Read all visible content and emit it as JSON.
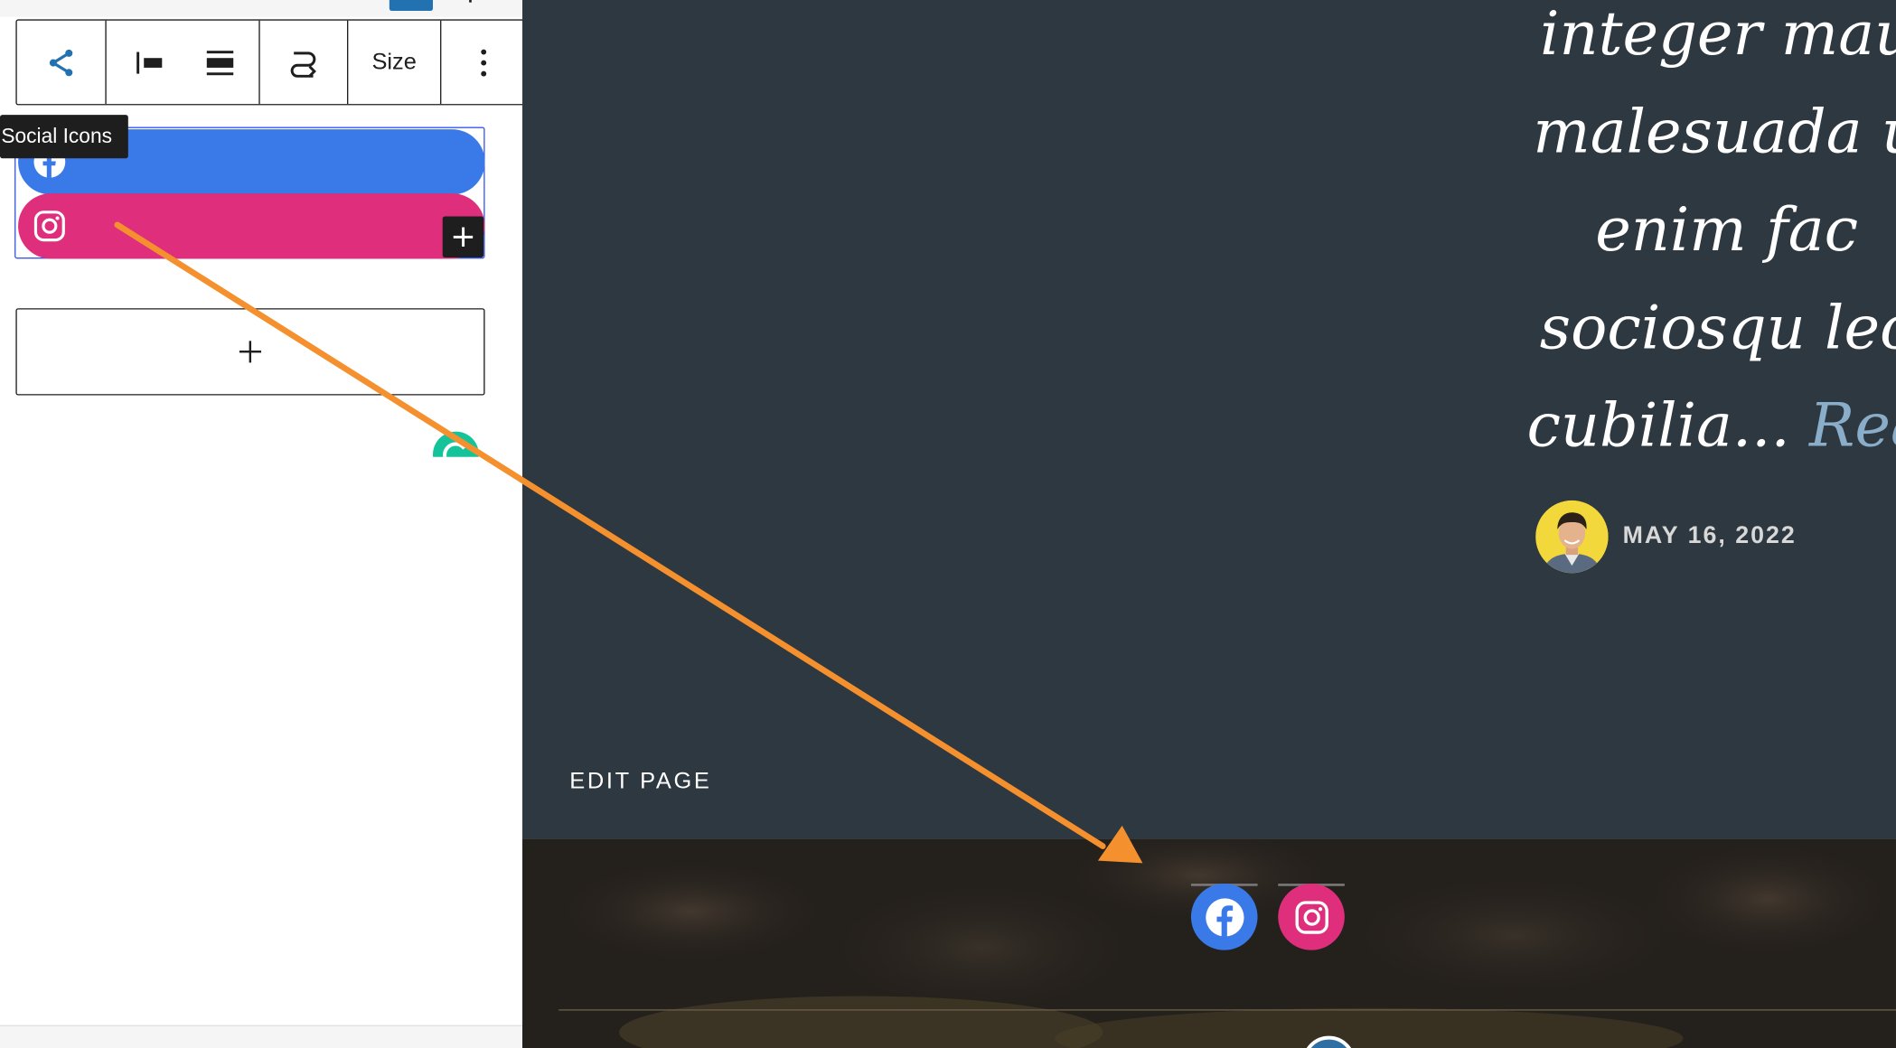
{
  "toolbar": {
    "size_label": "Size"
  },
  "tooltip": {
    "text": "Social Icons"
  },
  "social_block": {
    "items": [
      {
        "service": "facebook",
        "icon": "facebook-icon",
        "color": "#3a7ae8"
      },
      {
        "service": "instagram",
        "icon": "instagram-icon",
        "color": "#de2e7c"
      }
    ]
  },
  "post": {
    "excerpt_lines": [
      "integer mau",
      "malesuada u",
      "enim fac",
      "sociosqu lec",
      "cubilia..."
    ],
    "read_more": "Rea",
    "date": "MAY 16, 2022"
  },
  "page": {
    "edit_link": "EDIT PAGE"
  },
  "colors": {
    "accent_blue": "#3858e9",
    "facebook": "#3a7ae8",
    "instagram": "#de2e7c",
    "preview_bg": "#2e3840",
    "arrow": "#f5902e"
  }
}
